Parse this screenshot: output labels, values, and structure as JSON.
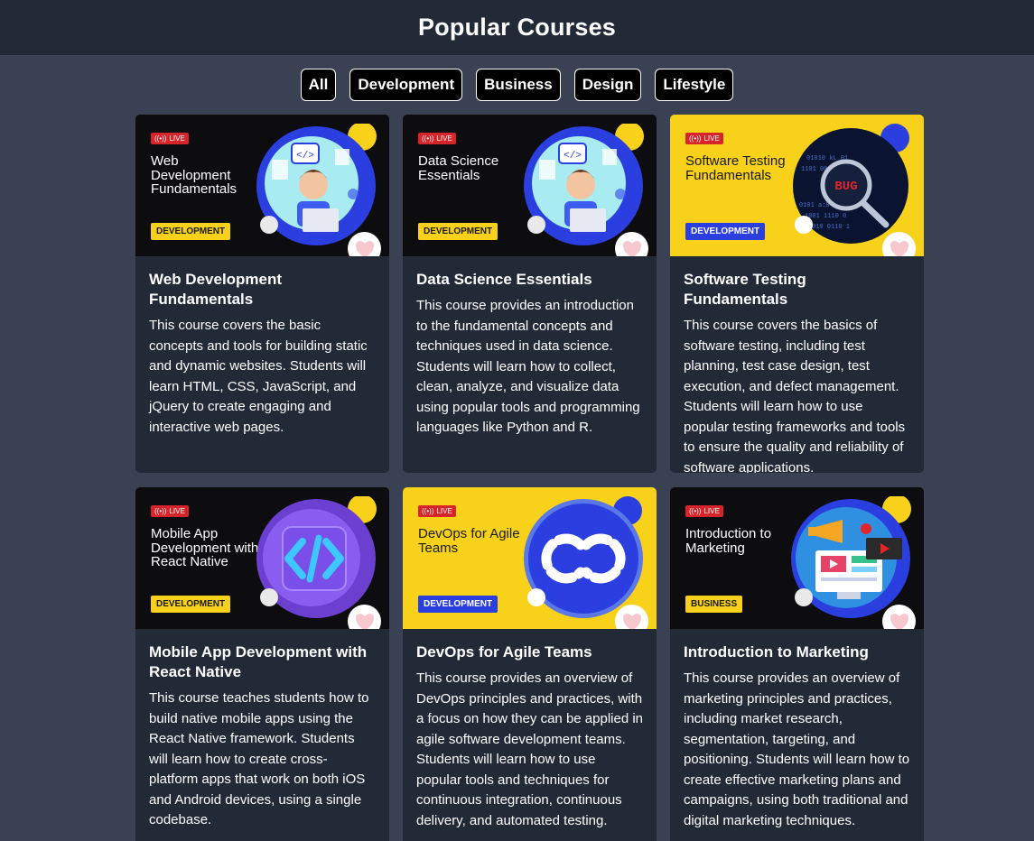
{
  "header": {
    "title": "Popular Courses"
  },
  "filters": [
    {
      "label": "All"
    },
    {
      "label": "Development"
    },
    {
      "label": "Business"
    },
    {
      "label": "Design"
    },
    {
      "label": "Lifestyle"
    }
  ],
  "courses": [
    {
      "title": "Web Development Fundamentals",
      "thumb_title": "Web Development Fundamentals",
      "tag": "DEVELOPMENT",
      "live_label": "LIVE",
      "theme": "dark",
      "art_icon": "developer-laptop-icon",
      "description": "This course covers the basic concepts and tools for building static and dynamic websites. Students will learn HTML, CSS, JavaScript, and jQuery to create engaging and interactive web pages."
    },
    {
      "title": "Data Science Essentials",
      "thumb_title": "Data Science Essentials",
      "tag": "DEVELOPMENT",
      "live_label": "LIVE",
      "theme": "dark",
      "art_icon": "developer-laptop-icon",
      "description": "This course provides an introduction to the fundamental concepts and techniques used in data science. Students will learn how to collect, clean, analyze, and visualize data using popular tools and programming languages like Python and R."
    },
    {
      "title": "Software Testing Fundamentals",
      "thumb_title": "Software Testing Fundamentals",
      "tag": "DEVELOPMENT",
      "live_label": "LIVE",
      "theme": "yellow",
      "art_icon": "bug-magnifier-icon",
      "art_text": "BUG",
      "description": "This course covers the basics of software testing, including test planning, test case design, test execution, and defect management. Students will learn how to use popular testing frameworks and tools to ensure the quality and reliability of software applications."
    },
    {
      "title": "Mobile App Development with React Native",
      "thumb_title": "Mobile App Development with React Native",
      "tag": "DEVELOPMENT",
      "live_label": "LIVE",
      "theme": "dark",
      "art_icon": "code-brackets-icon",
      "description": "This course teaches students how to build native mobile apps using the React Native framework. Students will learn how to create cross-platform apps that work on both iOS and Android devices, using a single codebase."
    },
    {
      "title": "DevOps for Agile Teams",
      "thumb_title": "DevOps for Agile Teams",
      "tag": "DEVELOPMENT",
      "live_label": "LIVE",
      "theme": "yellow",
      "art_icon": "infinity-loop-icon",
      "description": "This course provides an overview of DevOps principles and practices, with a focus on how they can be applied in agile software development teams. Students will learn how to use popular tools and techniques for continuous integration, continuous delivery, and automated testing."
    },
    {
      "title": "Introduction to Marketing",
      "thumb_title": "Introduction to Marketing",
      "tag": "BUSINESS",
      "live_label": "LIVE",
      "theme": "dark",
      "art_icon": "megaphone-screen-icon",
      "description": "This course provides an overview of marketing principles and practices, including market research, segmentation, targeting, and positioning. Students will learn how to create effective marketing plans and campaigns, using both traditional and digital marketing techniques."
    }
  ],
  "colors": {
    "page_bg": "#394152",
    "header_bg": "#222a38",
    "card_bg": "#222a38",
    "accent_yellow": "#f7d11a",
    "accent_blue": "#2b3fe0",
    "live_red": "#d5242a",
    "heart_pink": "#f8c8cf"
  },
  "icons": {
    "favorite": "heart-icon",
    "live": "broadcast-icon"
  }
}
